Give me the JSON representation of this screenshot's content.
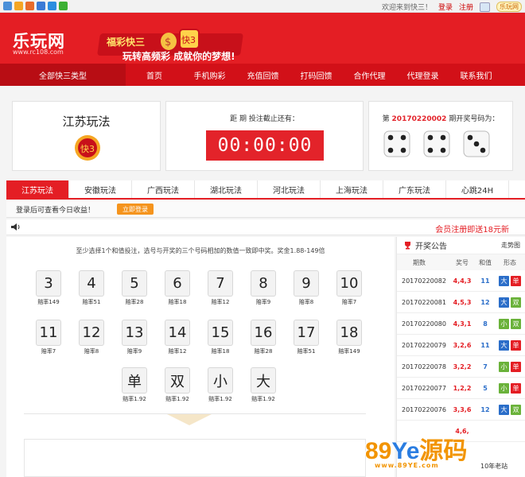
{
  "topbar": {
    "welcome": "欢迎来到快三！",
    "login": "登录",
    "register": "注册",
    "badge": "乐玩网",
    "icons": [
      "add-icon",
      "star-icon",
      "rss-icon",
      "share-icon",
      "people-icon",
      "wechat-icon"
    ]
  },
  "header": {
    "logo_cn": "乐玩网",
    "logo_url": "www.rc108.com",
    "banner_line1": "福彩快三",
    "banner_line2": "玩转高频彩 成就你的梦想!",
    "emblem_text": "快3"
  },
  "nav": {
    "category": "全部快三类型",
    "items": [
      "首页",
      "手机购彩",
      "充值回馈",
      "打码回馈",
      "合作代理",
      "代理登录",
      "联系我们"
    ]
  },
  "stage": {
    "game_name": "江苏玩法",
    "countdown_label": "距 期 投注截止还有：",
    "countdown": "00:00:00",
    "draw_prefix": "第",
    "draw_issue": "20170220002",
    "draw_suffix": "期开奖号码为：",
    "dice": [
      4,
      4,
      3
    ]
  },
  "tabs": [
    "江苏玩法",
    "安徽玩法",
    "广西玩法",
    "湖北玩法",
    "河北玩法",
    "上海玩法",
    "广东玩法",
    "心跳24H"
  ],
  "notice": {
    "text": "登录后可查看今日收益！",
    "button": "立即登录"
  },
  "announcement": {
    "promo": "会员注册即送18元新"
  },
  "bet": {
    "hint": "至少选择1个和值投注，选号与开奖的三个号码相加的数值一致即中奖。奖金1.88-149倍",
    "numbers": [
      {
        "value": "3",
        "odds": "赔率149"
      },
      {
        "value": "4",
        "odds": "赔率51"
      },
      {
        "value": "5",
        "odds": "赔率28"
      },
      {
        "value": "6",
        "odds": "赔率18"
      },
      {
        "value": "7",
        "odds": "赔率12"
      },
      {
        "value": "8",
        "odds": "赔率9"
      },
      {
        "value": "9",
        "odds": "赔率8"
      },
      {
        "value": "10",
        "odds": "赔率7"
      },
      {
        "value": "11",
        "odds": "赔率7"
      },
      {
        "value": "12",
        "odds": "赔率8"
      },
      {
        "value": "13",
        "odds": "赔率9"
      },
      {
        "value": "14",
        "odds": "赔率12"
      },
      {
        "value": "15",
        "odds": "赔率18"
      },
      {
        "value": "16",
        "odds": "赔率28"
      },
      {
        "value": "17",
        "odds": "赔率51"
      },
      {
        "value": "18",
        "odds": "赔率149"
      },
      {
        "value": "单",
        "odds": "赔率1.92"
      },
      {
        "value": "双",
        "odds": "赔率1.92"
      },
      {
        "value": "小",
        "odds": "赔率1.92"
      },
      {
        "value": "大",
        "odds": "赔率1.92"
      }
    ]
  },
  "results": {
    "title": "开奖公告",
    "trend": "走势图",
    "headers": [
      "期数",
      "奖号",
      "和值",
      "形态"
    ],
    "rows": [
      {
        "issue": "20170220082",
        "nums": "4,4,3",
        "sum": "11",
        "size": "大",
        "parity": "单"
      },
      {
        "issue": "20170220081",
        "nums": "4,5,3",
        "sum": "12",
        "size": "大",
        "parity": "双"
      },
      {
        "issue": "20170220080",
        "nums": "4,3,1",
        "sum": "8",
        "size": "小",
        "parity": "双"
      },
      {
        "issue": "20170220079",
        "nums": "3,2,6",
        "sum": "11",
        "size": "大",
        "parity": "单"
      },
      {
        "issue": "20170220078",
        "nums": "3,2,2",
        "sum": "7",
        "size": "小",
        "parity": "单"
      },
      {
        "issue": "20170220077",
        "nums": "1,2,2",
        "sum": "5",
        "size": "小",
        "parity": "单"
      },
      {
        "issue": "20170220076",
        "nums": "3,3,6",
        "sum": "12",
        "size": "大",
        "parity": "双"
      },
      {
        "issue": "",
        "nums": "4,6,",
        "sum": "",
        "size": "",
        "parity": ""
      }
    ],
    "colors": {
      "big": "#2b6ec9",
      "small": "#6ab23a",
      "odd": "#e41e24",
      "even": "#6ab23a"
    }
  },
  "watermark": {
    "prefix": "89",
    "ye": "Ye",
    "suffix": "源码",
    "url": "www.89YE.com",
    "tag": "10年老站"
  }
}
